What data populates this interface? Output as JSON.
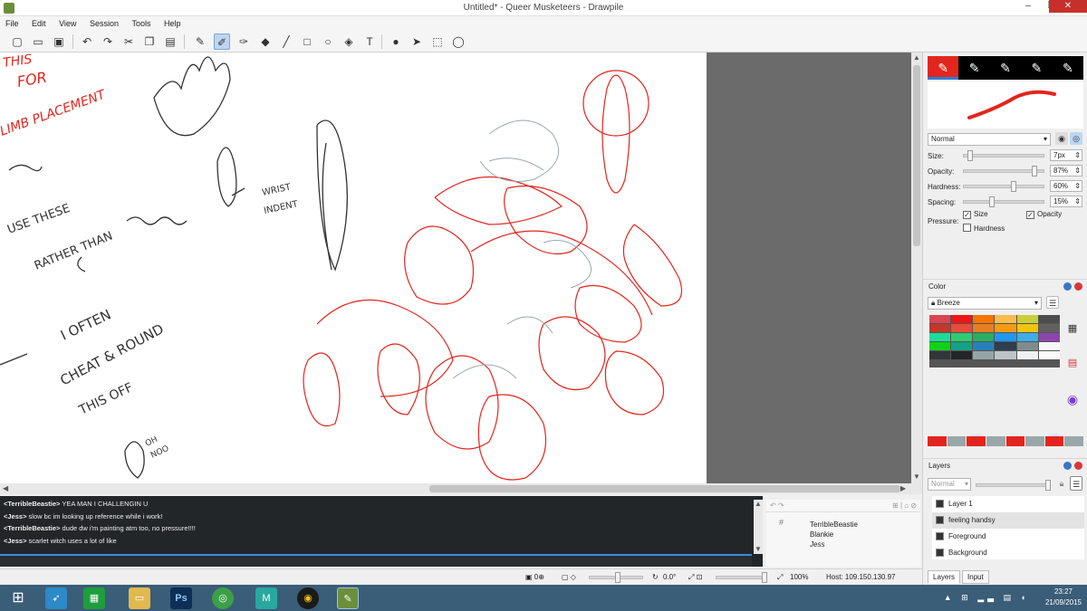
{
  "window": {
    "title": "Untitled* - Queer Musketeers - Drawpile",
    "minimize": "–",
    "maximize": "❐",
    "close": "✕"
  },
  "menu": [
    "File",
    "Edit",
    "View",
    "Session",
    "Tools",
    "Help"
  ],
  "canvas": {
    "notes_left": [
      "THIS",
      "FOR",
      "LIMB PLACEMENT",
      "USE THESE",
      "RATHER THAN",
      "I OFTEN",
      "CHEAT & ROUND",
      "THIS OFF",
      "OH",
      "NOO"
    ],
    "notes_mid": [
      "WRIST",
      "INDENT"
    ]
  },
  "brush": {
    "blend_mode": "Normal",
    "size_label": "Size:",
    "size_value": "7px",
    "size_level": 0.05,
    "opacity_label": "Opacity:",
    "opacity_value": "87%",
    "opacity_level": 0.87,
    "hardness_label": "Hardness:",
    "hardness_value": "60%",
    "hardness_level": 0.6,
    "spacing_label": "Spacing:",
    "spacing_value": "15%",
    "spacing_level": 0.15,
    "pressure_label": "Pressure:",
    "pressure_size": "Size",
    "pressure_opacity": "Opacity",
    "pressure_hardness": "Hardness",
    "accent": "#e2261d"
  },
  "color_panel": {
    "title": "Color",
    "palette": "Breeze",
    "swatches": [
      "#da4453",
      "#ed1515",
      "#f67400",
      "#fdbc4b",
      "#c9ce3b",
      "#4d4d4d",
      "#c0392b",
      "#e74c3c",
      "#e67e22",
      "#f39c12",
      "#f1c40f",
      "#616161",
      "#1cdc9a",
      "#2ecc71",
      "#27ae60",
      "#1d99f3",
      "#3daee9",
      "#8e44ad",
      "#11d116",
      "#16a085",
      "#2980b9",
      "#2c3e50",
      "#7f8c8d",
      "#f7f7f7",
      "#31363b",
      "#232629",
      "#95a5a6",
      "#bdc3c7",
      "#eff0f1",
      "#fcfcfc"
    ],
    "recent": [
      "#e2261d",
      "#9aa7a9",
      "#e2261d",
      "#9aa7a9",
      "#e2261d",
      "#9aa7a9",
      "#e2261d",
      "#9aa7a9"
    ]
  },
  "layers_panel": {
    "title": "Layers",
    "blend_mode": "Normal",
    "items": [
      {
        "name": "Layer 1",
        "selected": false
      },
      {
        "name": "feeling handsy",
        "selected": true
      },
      {
        "name": "Foreground",
        "selected": false
      },
      {
        "name": "Background",
        "selected": false
      }
    ],
    "tabs": [
      "Layers",
      "Input"
    ]
  },
  "chat": {
    "lines": [
      {
        "who": "<TerribleBeastie>",
        "text": " YEA MAN I CHALLENGIN U"
      },
      {
        "who": "<Jess>",
        "text": " slow bc im looking up reference while i work!"
      },
      {
        "who": "<TerribleBeastie>",
        "text": " dude dw i'm painting atm too, no pressure!!!!"
      },
      {
        "who": "<Jess>",
        "text": " scarlet witch uses a lot of like"
      }
    ]
  },
  "users": {
    "list": [
      "TerribleBeastie",
      "Blankie",
      "Jess"
    ]
  },
  "status": {
    "rotation": "0.0°",
    "zoom": "100%",
    "host": "Host: 109.150.130.97"
  },
  "taskbar": {
    "time": "23:27",
    "date": "21/09/2015",
    "bg": "#3a5d78"
  }
}
